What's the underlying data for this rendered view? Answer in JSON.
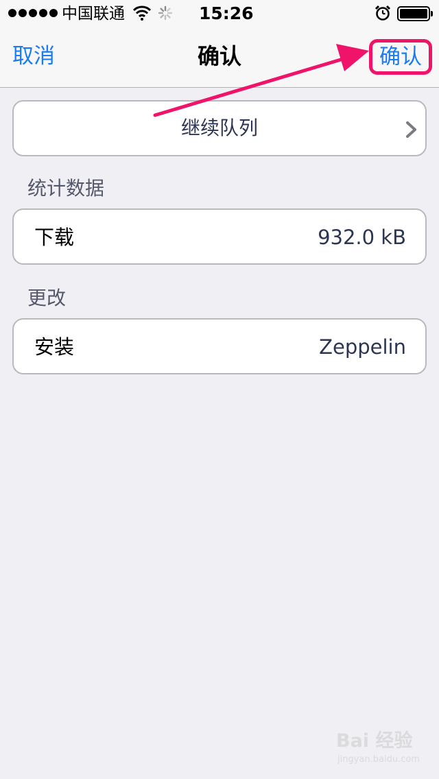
{
  "status_bar": {
    "carrier": "中国联通",
    "time": "15:26",
    "icons": [
      "signal-dots-icon",
      "wifi-icon",
      "activity-spinner-icon",
      "alarm-clock-icon",
      "battery-icon"
    ]
  },
  "nav": {
    "cancel_label": "取消",
    "title": "确认",
    "confirm_label": "确认"
  },
  "queue": {
    "label": "继续队列",
    "icon": "chevron-right-icon"
  },
  "stats": {
    "header": "统计数据",
    "download_label": "下载",
    "download_value": "932.0 kB"
  },
  "changes": {
    "header": "更改",
    "install_label": "安装",
    "install_value": "Zeppelin"
  },
  "watermark": {
    "logo": "Bai 经验",
    "url": "jingyan.baidu.com"
  },
  "colors": {
    "accent": "#1a7cf4",
    "annotation": "#f0136a",
    "background": "#efeff4",
    "value_text": "#2c3553"
  }
}
